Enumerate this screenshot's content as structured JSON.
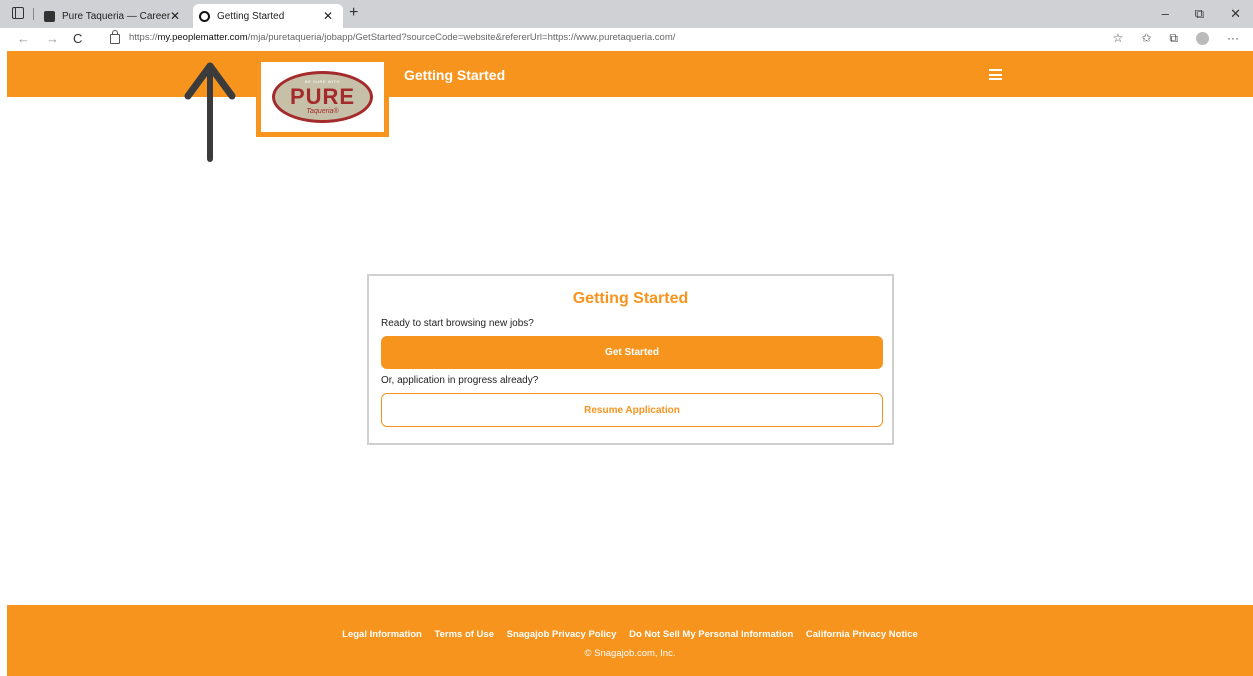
{
  "browser": {
    "tabs": [
      {
        "title": "Pure Taqueria — Careers",
        "active": false
      },
      {
        "title": "Getting Started",
        "active": true
      }
    ],
    "url_prefix": "https://",
    "url_host": "my.peoplematter.com",
    "url_path": "/mja/puretaqueria/jobapp/GetStarted?sourceCode=website&refererUrl=https://www.puretaqueria.com/",
    "icons": {
      "workspaces": "workspaces-icon",
      "new_tab": "+",
      "back": "←",
      "forward": "→",
      "reload": "C",
      "minimize": "–",
      "restore": "⧉",
      "close": "✕",
      "favorites": "☆",
      "collections": "⧉",
      "profile": "avatar",
      "menu": "···"
    }
  },
  "header": {
    "title": "Getting Started",
    "logo": {
      "tagline": "BE SURE WITH",
      "word": "PURE",
      "sub": "Taqueria®"
    },
    "menu_icon": "hamburger-menu-icon",
    "color": "#f7941d"
  },
  "card": {
    "title": "Getting Started",
    "prompt_new": "Ready to start browsing new jobs?",
    "primary_button": "Get Started",
    "prompt_existing": "Or, application in progress already?",
    "secondary_button": "Resume Application"
  },
  "footer": {
    "links": [
      "Legal Information",
      "Terms of Use",
      "Snagajob Privacy Policy",
      "Do Not Sell My Personal Information",
      "California Privacy Notice"
    ],
    "copyright": "© Snagajob.com, Inc."
  },
  "annotation": {
    "arrow": "up-arrow-annotation",
    "color": "#3b3b3b"
  }
}
